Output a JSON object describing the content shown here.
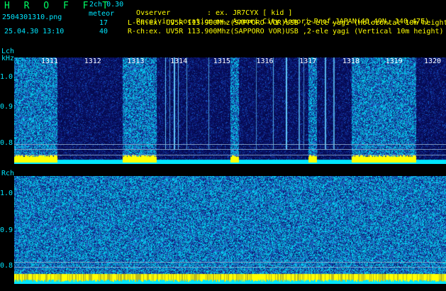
{
  "header": {
    "brand": "H R O F F T",
    "mode": "2ch 0.30",
    "filename": "2504301310.png",
    "timestamp": "25.04.30 13:10",
    "meteor_label": "meteor",
    "meteor_count_l": "17",
    "meteor_count_r": "40",
    "observer_key": "Ovserver",
    "observer_val": ": ex. JR7CYX [ kid ]",
    "location_key": "Receiving Location",
    "location_val": ": ex. Aomori City Aomori-Pref.JAPAN(40.49N, 140.47E)",
    "lch_info": "L-ch:ex. UV5R 113.900Mhz(SAPPORO VOR)USB ,2-ele yagi (Holozontal 10m height)",
    "rch_info": "R-ch:ex. UV5R 113.900Mhz(SAPPORO VOR)USB ,2-ele yagi (Vertical 10m height)"
  },
  "lch": {
    "label": "Lch",
    "unit": "kHz",
    "ticks": [
      "1.0",
      "0.9",
      "0.8"
    ]
  },
  "rch": {
    "label": "Rch",
    "ticks": [
      "1.0",
      "0.9",
      "0.8"
    ]
  },
  "minutes": [
    "1311",
    "1312",
    "1313",
    "1314",
    "1315",
    "1316",
    "1317",
    "1318",
    "1319",
    "1320"
  ],
  "colors": {
    "background": "#000000",
    "label_green": "#00ff66",
    "label_cyan": "#00e6ff",
    "label_yellow": "#ffff00",
    "noise_dark": "#0a1a7a",
    "noise_bright": "#00e0ff",
    "signal_band": "#ffff00"
  },
  "lch_active_segments": [
    [
      0.0,
      0.1
    ],
    [
      0.25,
      0.33
    ],
    [
      0.5,
      0.52
    ],
    [
      0.68,
      0.7
    ],
    [
      0.78,
      0.93
    ]
  ]
}
